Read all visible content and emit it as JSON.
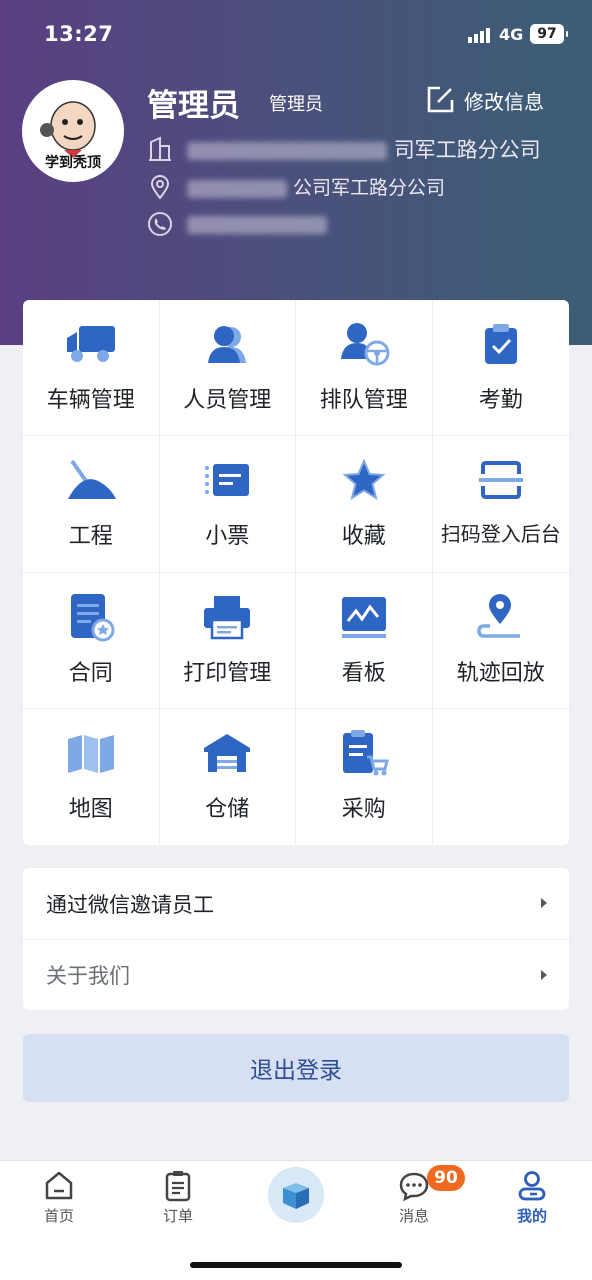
{
  "status_bar": {
    "time": "13:27",
    "network": "4G",
    "battery": "97"
  },
  "profile": {
    "avatar_caption": "学到秃顶",
    "name": "管理员",
    "role": "管理员",
    "edit_label": "修改信息",
    "company_visible": "司军工路分公司",
    "address_visible": "公司军工路分公司"
  },
  "grid": {
    "items": [
      {
        "label": "车辆管理",
        "icon": "truck-icon"
      },
      {
        "label": "人员管理",
        "icon": "person-icon"
      },
      {
        "label": "排队管理",
        "icon": "person-wheel-icon"
      },
      {
        "label": "考勤",
        "icon": "clipboard-check-icon"
      },
      {
        "label": "工程",
        "icon": "excavator-icon"
      },
      {
        "label": "小票",
        "icon": "receipt-icon"
      },
      {
        "label": "收藏",
        "icon": "star-icon"
      },
      {
        "label": "扫码登入后台",
        "icon": "scan-icon"
      },
      {
        "label": "合同",
        "icon": "contract-icon"
      },
      {
        "label": "打印管理",
        "icon": "printer-icon"
      },
      {
        "label": "看板",
        "icon": "dashboard-icon"
      },
      {
        "label": "轨迹回放",
        "icon": "track-pin-icon"
      },
      {
        "label": "地图",
        "icon": "map-icon"
      },
      {
        "label": "仓储",
        "icon": "warehouse-icon"
      },
      {
        "label": "采购",
        "icon": "purchase-icon"
      }
    ]
  },
  "list": {
    "invite_label": "通过微信邀请员工",
    "about_label": "关于我们"
  },
  "logout_label": "退出登录",
  "tabbar": {
    "home": "首页",
    "orders": "订单",
    "messages": "消息",
    "messages_badge": "90",
    "mine": "我的"
  },
  "colors": {
    "accent": "#2e5fb8",
    "icon_blue": "#2f66c3",
    "badge": "#ef6a20"
  }
}
